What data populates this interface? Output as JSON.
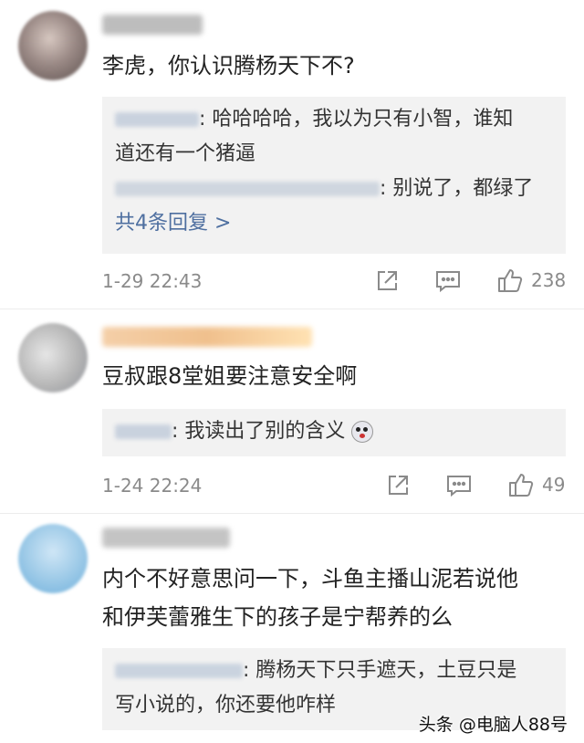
{
  "comments": [
    {
      "text": "李虎，你认识腾杨天下不?",
      "replies": [
        "哈哈哈哈，我以为只有小智，谁知",
        "道还有一个猪逼",
        "别说了，都绿了"
      ],
      "more": "共4条回复 >",
      "time": "1-29 22:43",
      "likes": "238"
    },
    {
      "text": "豆叔跟8堂姐要注意安全啊",
      "replies": [
        "我读出了别的含义"
      ],
      "time": "1-24 22:24",
      "likes": "49"
    },
    {
      "text_lines": [
        "内个不好意思问一下，斗鱼主播山泥若说他",
        "和伊芙蕾雅生下的孩子是宁帮养的么"
      ],
      "replies": [
        "腾杨天下只手遮天，土豆只是",
        "写小说的，你还要他咋样"
      ]
    }
  ],
  "watermark": "头条 @电脑人88号",
  "icons": [
    "share-icon",
    "comment-icon",
    "like-icon"
  ]
}
